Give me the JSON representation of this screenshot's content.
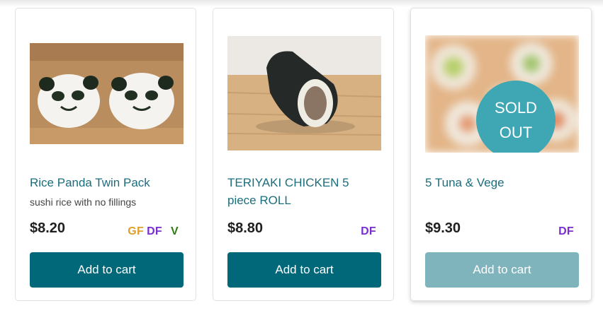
{
  "products": [
    {
      "title": "Rice Panda Twin Pack",
      "description": "sushi rice with no fillings",
      "price": "$8.20",
      "tags": [
        "GF",
        "DF",
        "V"
      ],
      "button_label": "Add to cart",
      "image_icon": "panda-rice-balls-image"
    },
    {
      "title": "TERIYAKI CHICKEN 5 piece ROLL",
      "price": "$8.80",
      "tags": [
        "DF"
      ],
      "button_label": "Add to cart",
      "image_icon": "sushi-roll-image"
    },
    {
      "title": "5 Tuna & Vege",
      "price": "$9.30",
      "tags": [
        "DF"
      ],
      "button_label": "Add to cart",
      "sold_out_line1": "SOLD",
      "sold_out_line2": "OUT",
      "image_icon": "tuna-vege-rolls-image"
    }
  ],
  "colors": {
    "title": "#1b6e7c",
    "button": "#006879",
    "button_disabled": "#7fb4bc",
    "sold_out_badge": "#3fa6b4",
    "gf_tag": "#e0a02a",
    "df_tag": "#7a2ed0",
    "v_tag": "#2e7d12"
  }
}
